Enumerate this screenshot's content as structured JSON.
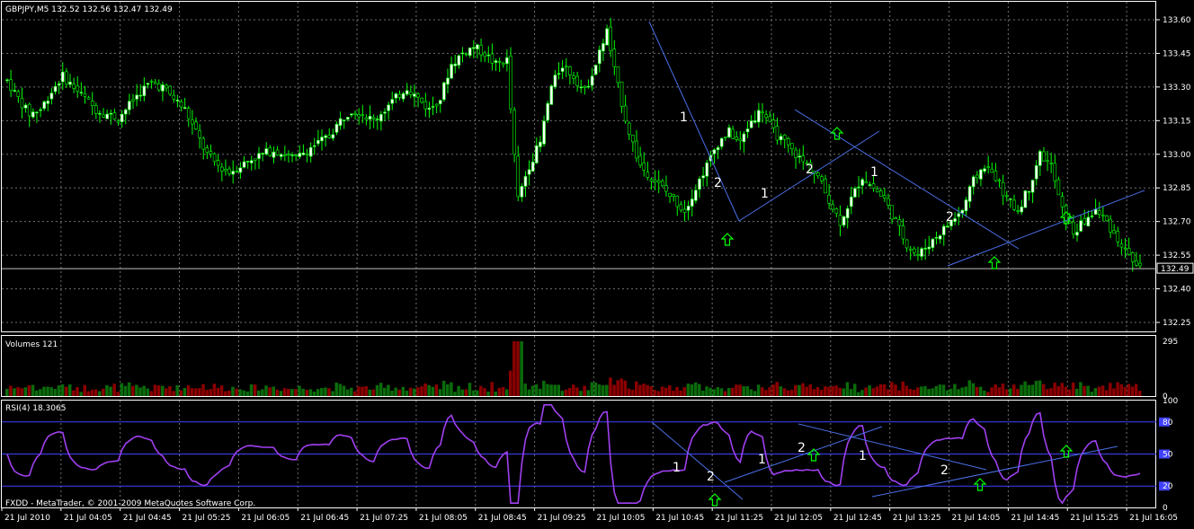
{
  "main": {
    "symbol_info": "GBPJPY,M5  132.52 132.56 132.47 132.49",
    "y_ticks": [
      "133.60",
      "133.45",
      "133.30",
      "133.15",
      "133.00",
      "132.85",
      "132.70",
      "132.55",
      "132.40",
      "132.25"
    ],
    "ylim": [
      132.21,
      133.68
    ],
    "current_price": 132.49,
    "current_price_label": "132.49",
    "annotations": [
      "1",
      "2",
      "1",
      "2",
      "1",
      "2"
    ]
  },
  "volume": {
    "label": "Volumes 121",
    "y_ticks": [
      "295",
      "0"
    ],
    "ylim": [
      0,
      295
    ]
  },
  "rsi": {
    "label": "RSI(4) 18.3065",
    "y_ticks": [
      "100",
      "80",
      "50",
      "20",
      "0"
    ],
    "levels": [
      80,
      50,
      20
    ],
    "annotations": [
      "1",
      "2",
      "1",
      "2",
      "1",
      "2"
    ]
  },
  "copyright": "FXDD - MetaTrader, © 2001-2009 MetaQuotes Software Corp.",
  "x_labels": [
    "21 Jul 2010",
    "21 Jul 04:05",
    "21 Jul 04:45",
    "21 Jul 05:25",
    "21 Jul 06:05",
    "21 Jul 06:45",
    "21 Jul 07:25",
    "21 Jul 08:05",
    "21 Jul 08:45",
    "21 Jul 09:25",
    "21 Jul 10:05",
    "21 Jul 10:45",
    "21 Jul 11:25",
    "21 Jul 12:05",
    "21 Jul 12:45",
    "21 Jul 13:25",
    "21 Jul 14:05",
    "21 Jul 14:45",
    "21 Jul 15:25",
    "21 Jul 16:05"
  ],
  "colors": {
    "bull_candle": "#ffffff",
    "bear_candle": "#000000",
    "wick": "#00ff00",
    "vol_up": "#0b6b0b",
    "vol_down": "#8b0000",
    "rsi_line": "#a040f0",
    "rsi_levels": "#4040ff",
    "trendline": "#4a6fe8",
    "arrow": "#00ff00",
    "grid": "#707070"
  },
  "chart_data": [
    {
      "type": "candlestick",
      "title": "GBPJPY,M5",
      "ylim": [
        132.21,
        133.68
      ],
      "close_path": [
        133.33,
        133.25,
        133.18,
        133.2,
        133.28,
        133.35,
        133.3,
        133.25,
        133.2,
        133.18,
        133.16,
        133.22,
        133.28,
        133.32,
        133.3,
        133.25,
        133.2,
        133.1,
        133.0,
        132.95,
        132.92,
        132.95,
        132.98,
        133.0,
        133.02,
        133.0,
        132.98,
        133.02,
        133.05,
        133.08,
        133.15,
        133.2,
        133.18,
        133.15,
        133.2,
        133.25,
        133.3,
        133.25,
        133.2,
        133.25,
        133.4,
        133.45,
        133.48,
        133.45,
        133.4,
        133.42,
        132.8,
        132.95,
        133.05,
        133.3,
        133.4,
        133.35,
        133.28,
        133.4,
        133.55,
        133.3,
        133.1,
        132.95,
        132.9,
        132.85,
        132.8,
        132.75,
        132.85,
        132.95,
        133.05,
        133.1,
        133.05,
        133.15,
        133.2,
        133.1,
        133.05,
        133.0,
        132.95,
        132.9,
        132.8,
        132.7,
        132.8,
        132.9,
        132.85,
        132.8,
        132.7,
        132.6,
        132.55,
        132.6,
        132.65,
        132.7,
        132.75,
        132.88,
        132.95,
        132.9,
        132.8,
        132.75,
        132.85,
        133.0,
        132.95,
        132.75,
        132.65,
        132.7,
        132.75,
        132.7,
        132.62,
        132.55,
        132.49
      ],
      "series": [
        {
          "name": "Volumes",
          "type": "bar",
          "note": "volume per candle, tall spike near 09:30 (295)"
        },
        {
          "name": "RSI(4)",
          "type": "line",
          "last": 18.3065
        }
      ]
    }
  ]
}
